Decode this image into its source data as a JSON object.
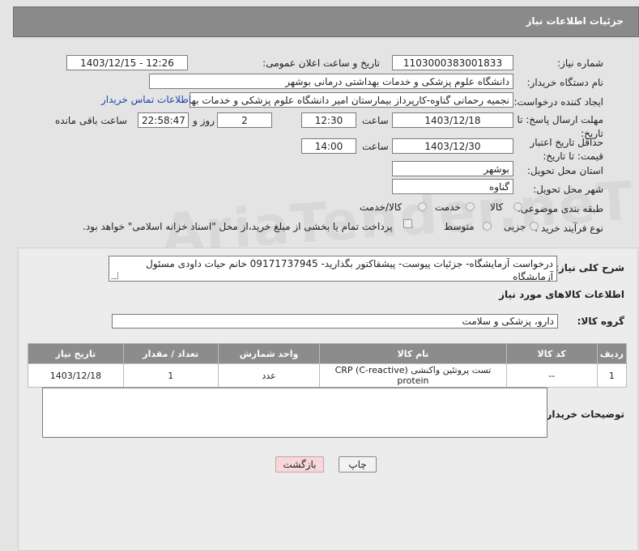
{
  "header": {
    "title": "جزئیات اطلاعات نیاز"
  },
  "fields": {
    "need_number_label": "شماره نیاز:",
    "need_number": "1103000383001833",
    "announce_label": "تاریخ و ساعت اعلان عمومی:",
    "announce_value": "1403/12/15 - 12:26",
    "buyer_org_label": "نام دستگاه خریدار:",
    "buyer_org": "دانشگاه علوم پزشکی و خدمات بهداشتی درمانی بوشهر",
    "creator_label": "ایجاد کننده درخواست:",
    "creator": "نجمیه رحمانی گناوه-کارپرداز بیمارستان امیر دانشگاه علوم پزشکی و خدمات بهد",
    "buyer_contact_link": "اطلاعات تماس خریدار",
    "deadline_label": "مهلت ارسال پاسخ: تا تاریخ:",
    "deadline_date": "1403/12/18",
    "time_label": "ساعت",
    "deadline_time": "12:30",
    "days_value": "2",
    "days_label": "روز و",
    "remaining_time": "22:58:47",
    "remaining_label": "ساعت باقی مانده",
    "validity_label": "حداقل تاریخ اعتبار قیمت: تا تاریخ:",
    "validity_date": "1403/12/30",
    "validity_time": "14:00",
    "province_label": "استان محل تحویل:",
    "province": "بوشهر",
    "city_label": "شهر محل تحویل:",
    "city": "گناوه",
    "category_label": "طبقه بندی موضوعی:",
    "category_options": [
      "کالا",
      "خدمت",
      "کالا/خدمت"
    ],
    "process_label": "نوع فرآیند خرید :",
    "process_options": [
      "جزیی",
      "متوسط"
    ],
    "payment_note": "پرداخت تمام یا بخشی از مبلغ خرید،از محل \"اسناد خزانه اسلامی\" خواهد بود."
  },
  "summary": {
    "label": "شرح کلی نیاز:",
    "text": "درخواست آزمایشگاه- جزئیات پیوست- پیشفاکتور بگذارید- 09171737945 خانم حیات داودی مسئول آزمایشگاه"
  },
  "goods": {
    "title": "اطلاعات کالاهای مورد نیاز",
    "group_label": "گروه کالا:",
    "group_value": "دارو، پزشکی و سلامت",
    "table": {
      "headers": [
        "ردیف",
        "کد کالا",
        "نام کالا",
        "واحد شمارش",
        "تعداد / مقدار",
        "تاریخ نیاز"
      ],
      "rows": [
        [
          "1",
          "--",
          "تست پروتئین واکنشی (CRP (C-reactive protein",
          "عدد",
          "1",
          "1403/12/18"
        ]
      ]
    }
  },
  "buyer_notes": {
    "label": "توضیحات خریدار:",
    "text": ""
  },
  "buttons": {
    "print": "چاپ",
    "back": "بازگشت"
  },
  "watermark": "AriaTender.neT"
}
